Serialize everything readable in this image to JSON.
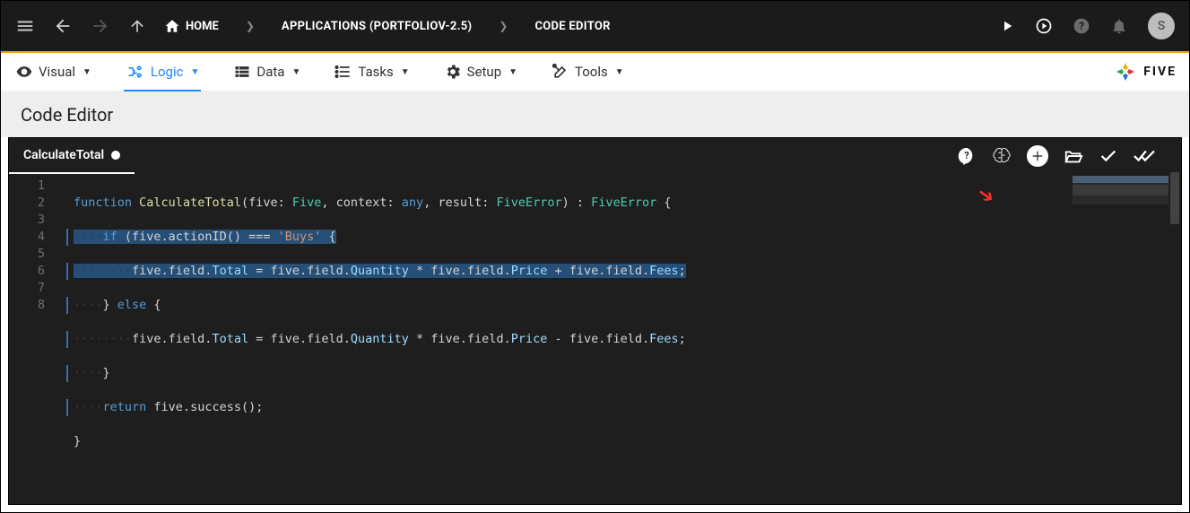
{
  "topbar": {
    "home": "HOME",
    "crumb1": "APPLICATIONS (PORTFOLIOV-2.5)",
    "crumb2": "CODE EDITOR",
    "avatar_initial": "S"
  },
  "tabs": {
    "visual": "Visual",
    "logic": "Logic",
    "data": "Data",
    "tasks": "Tasks",
    "setup": "Setup",
    "tools": "Tools"
  },
  "brand": {
    "name": "FIVE"
  },
  "header": {
    "title": "Code Editor"
  },
  "editor": {
    "file_name": "CalculateTotal",
    "icons": {
      "help": "help-icon",
      "brain": "brain-icon",
      "add": "add-icon",
      "open": "open-folder-icon",
      "save": "check-icon",
      "saveall": "check-all-icon"
    },
    "lines": [
      "1",
      "2",
      "3",
      "4",
      "5",
      "6",
      "7",
      "8"
    ],
    "code": {
      "l1": {
        "kw": "function",
        "sp": " ",
        "fn": "CalculateTotal",
        "open": "(five: ",
        "t1": "Five",
        "c1": ", context: ",
        "t2": "any",
        "c2": ", result: ",
        "t3": "FiveError",
        "close": ") : ",
        "t4": "FiveError",
        "brace": " {"
      },
      "l2": {
        "ws": "····",
        "kw": "if",
        "txt": " (five.actionID() === ",
        "str": "'Buys'",
        "end": " {"
      },
      "l3": {
        "ws": "········",
        "a": "five.field.",
        "p1": "Total",
        "eq": " = five.field.",
        "p2": "Quantity",
        "m": " * five.field.",
        "p3": "Price",
        "pl": " + five.field.",
        "p4": "Fees",
        "sc": ";"
      },
      "l4": {
        "ws": "····",
        "a": "} ",
        "kw": "else",
        "b": " {"
      },
      "l5": {
        "ws": "········",
        "a": "five.field.",
        "p1": "Total",
        "eq": " = five.field.",
        "p2": "Quantity",
        "m": " * five.field.",
        "p3": "Price",
        "pl": " - five.field.",
        "p4": "Fees",
        "sc": ";"
      },
      "l6": {
        "ws": "····",
        "a": "}"
      },
      "l7": {
        "ws": "····",
        "kw": "return",
        "a": " five.success();"
      },
      "l8": {
        "a": "}"
      }
    }
  }
}
